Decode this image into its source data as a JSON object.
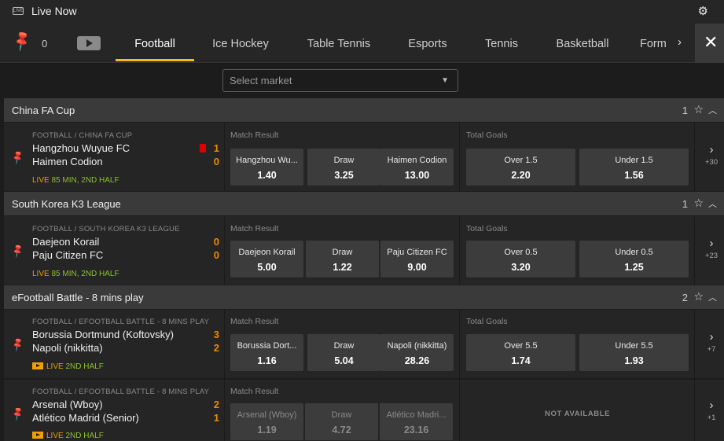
{
  "header": {
    "live_icon": "LIVE",
    "title": "Live Now",
    "settings_icon": "gear-icon"
  },
  "tabs": {
    "pinned_count": "0",
    "items": [
      "Football",
      "Ice Hockey",
      "Table Tennis",
      "Esports",
      "Tennis",
      "Basketball",
      "Form"
    ],
    "active": "Football"
  },
  "market_select": {
    "placeholder": "Select market"
  },
  "leagues": [
    {
      "name": "China FA Cup",
      "count": "1"
    },
    {
      "name": "South Korea K3 League",
      "count": "1"
    },
    {
      "name": "eFootball Battle - 8 mins play",
      "count": "2"
    }
  ],
  "matches": [
    {
      "path": "FOOTBALL / CHINA FA CUP",
      "home": "Hangzhou Wuyue FC",
      "away": "Haimen Codion",
      "home_score": "1",
      "away_score": "0",
      "live": "LIVE",
      "time": "85 MIN, 2ND HALF",
      "match_result_label": "Match Result",
      "mr": [
        {
          "label": "Hangzhou Wu...",
          "odd": "1.40"
        },
        {
          "label": "Draw",
          "odd": "3.25"
        },
        {
          "label": "Haimen Codion",
          "odd": "13.00"
        }
      ],
      "total_goals_label": "Total Goals",
      "tg": [
        {
          "label": "Over 1.5",
          "odd": "2.20"
        },
        {
          "label": "Under 1.5",
          "odd": "1.56"
        }
      ],
      "more": "+30"
    },
    {
      "path": "FOOTBALL / SOUTH KOREA K3 LEAGUE",
      "home": "Daejeon Korail",
      "away": "Paju Citizen FC",
      "home_score": "0",
      "away_score": "0",
      "live": "LIVE",
      "time": "85 MIN, 2ND HALF",
      "match_result_label": "Match Result",
      "mr": [
        {
          "label": "Daejeon Korail",
          "odd": "5.00"
        },
        {
          "label": "Draw",
          "odd": "1.22"
        },
        {
          "label": "Paju Citizen FC",
          "odd": "9.00"
        }
      ],
      "total_goals_label": "Total Goals",
      "tg": [
        {
          "label": "Over 0.5",
          "odd": "3.20"
        },
        {
          "label": "Under 0.5",
          "odd": "1.25"
        }
      ],
      "more": "+23"
    },
    {
      "path": "FOOTBALL / EFOOTBALL BATTLE - 8 MINS PLAY",
      "home": "Borussia Dortmund (Koftovsky)",
      "away": "Napoli (nikkitta)",
      "home_score": "3",
      "away_score": "2",
      "live": "LIVE",
      "time": "2ND HALF",
      "match_result_label": "Match Result",
      "mr": [
        {
          "label": "Borussia Dort...",
          "odd": "1.16"
        },
        {
          "label": "Draw",
          "odd": "5.04"
        },
        {
          "label": "Napoli (nikkitta)",
          "odd": "28.26"
        }
      ],
      "total_goals_label": "Total Goals",
      "tg": [
        {
          "label": "Over 5.5",
          "odd": "1.74"
        },
        {
          "label": "Under 5.5",
          "odd": "1.93"
        }
      ],
      "more": "+7"
    },
    {
      "path": "FOOTBALL / EFOOTBALL BATTLE - 8 MINS PLAY",
      "home": "Arsenal (Wboy)",
      "away": "Atlético Madrid (Senior)",
      "home_score": "2",
      "away_score": "1",
      "live": "LIVE",
      "time": "2ND HALF",
      "match_result_label": "Match Result",
      "mr": [
        {
          "label": "Arsenal (Wboy)",
          "odd": "1.19"
        },
        {
          "label": "Draw",
          "odd": "4.72"
        },
        {
          "label": "Atlético Madri...",
          "odd": "23.16"
        }
      ],
      "not_available": "NOT AVAILABLE",
      "more": "+1"
    }
  ]
}
